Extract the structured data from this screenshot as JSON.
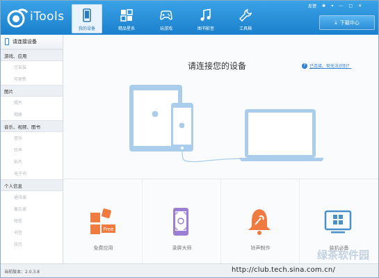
{
  "app": {
    "name": "iTools",
    "logo": "itools-logo",
    "accent": "#1f86d6"
  },
  "nav": [
    {
      "label": "我的设备",
      "icon": "phone-icon",
      "active": true
    },
    {
      "label": "精品星系",
      "icon": "grid-icon",
      "active": false
    },
    {
      "label": "玩游戏",
      "icon": "gamepad-icon",
      "active": false
    },
    {
      "label": "图书影音",
      "icon": "music-icon",
      "active": false
    },
    {
      "label": "工具箱",
      "icon": "wrench-icon",
      "active": false
    }
  ],
  "top_links": {
    "feedback": "反馈"
  },
  "download_button": {
    "label": "下载中心",
    "icon": "download-icon"
  },
  "sidebar": {
    "active_item": "请连接设备",
    "groups": [
      {
        "title": "游戏、应用",
        "items": [
          "已安装",
          "可更新"
        ]
      },
      {
        "title": "图片",
        "items": [
          "照片",
          "相册"
        ]
      },
      {
        "title": "音乐、视频、图书",
        "items": [
          "音乐",
          "铃声",
          "影片",
          "电子书"
        ]
      },
      {
        "title": "个人信息",
        "items": [
          "通讯录",
          "备忘录",
          "短信",
          "书签",
          "日历"
        ]
      }
    ]
  },
  "main": {
    "title": "请连接您的设备",
    "connected_link": "已连接，但无法识别？"
  },
  "apps": [
    {
      "label": "免费应用",
      "icon": "free-apps-icon"
    },
    {
      "label": "录屏大师",
      "icon": "screen-recorder-icon"
    },
    {
      "label": "铃声制作",
      "icon": "ringtone-maker-icon"
    },
    {
      "label": "装机必备",
      "icon": "desktop-icon"
    }
  ],
  "status": {
    "version": "当前版本：2.0.3.8"
  },
  "watermark": {
    "url": "http://club.tech.sina.com.cn/",
    "logo": "绿茶软件园"
  }
}
